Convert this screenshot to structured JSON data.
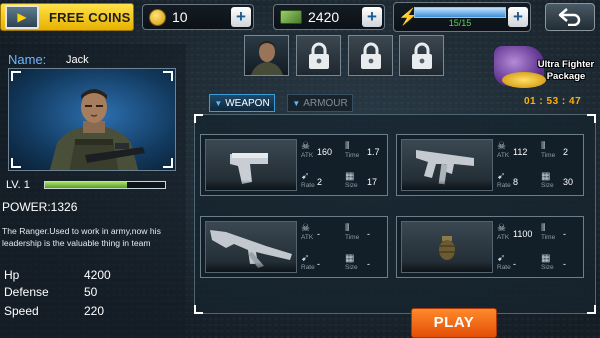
{
  "topbar": {
    "free_coins_label": "FREE COINS",
    "coins_value": "10",
    "cash_value": "2420",
    "energy_value": "15/15",
    "plus_symbol": "+",
    "back_icon": "back-arrow-icon"
  },
  "character": {
    "name_label": "Name:",
    "name": "Jack",
    "level_label": "LV. 1",
    "level_progress": 0.68,
    "power": "POWER:1326",
    "description": "The Ranger.Used to work in army,now his leadership is the valuable thing in team",
    "stats": [
      {
        "label": "Hp",
        "value": "4200"
      },
      {
        "label": "Defense",
        "value": "50"
      },
      {
        "label": "Speed",
        "value": "220"
      }
    ]
  },
  "slots": {
    "locked_count": 3,
    "active_icon": "soldier-portrait",
    "locked_icon": "lock-icon"
  },
  "package": {
    "label_line1": "Ultra Fighter",
    "label_line2": "Package",
    "timer": "01 : 53 : 47"
  },
  "tabs": [
    {
      "label": "WEAPON",
      "active": true
    },
    {
      "label": "ARMOUR",
      "active": false
    }
  ],
  "stat_captions": {
    "atk": "ATK",
    "time": "Time",
    "rate": "Rate",
    "size": "Size"
  },
  "weapons": [
    {
      "type": "pistol",
      "atk": "160",
      "time": "1.7",
      "rate": "2",
      "size": "17"
    },
    {
      "type": "smg",
      "atk": "112",
      "time": "2",
      "rate": "8",
      "size": "30"
    },
    {
      "type": "rifle",
      "atk": "-",
      "time": "-",
      "rate": "-",
      "size": "-"
    },
    {
      "type": "grenade",
      "atk": "1100",
      "time": "-",
      "rate": "-",
      "size": "-"
    }
  ],
  "play_label": "PLAY",
  "colors": {
    "accent_blue": "#3e9bd6",
    "play_orange": "#ff7a1a",
    "free_coins_yellow": "#ffd21f",
    "timer_orange": "#ffb000",
    "energy_green": "#5fd05f"
  }
}
